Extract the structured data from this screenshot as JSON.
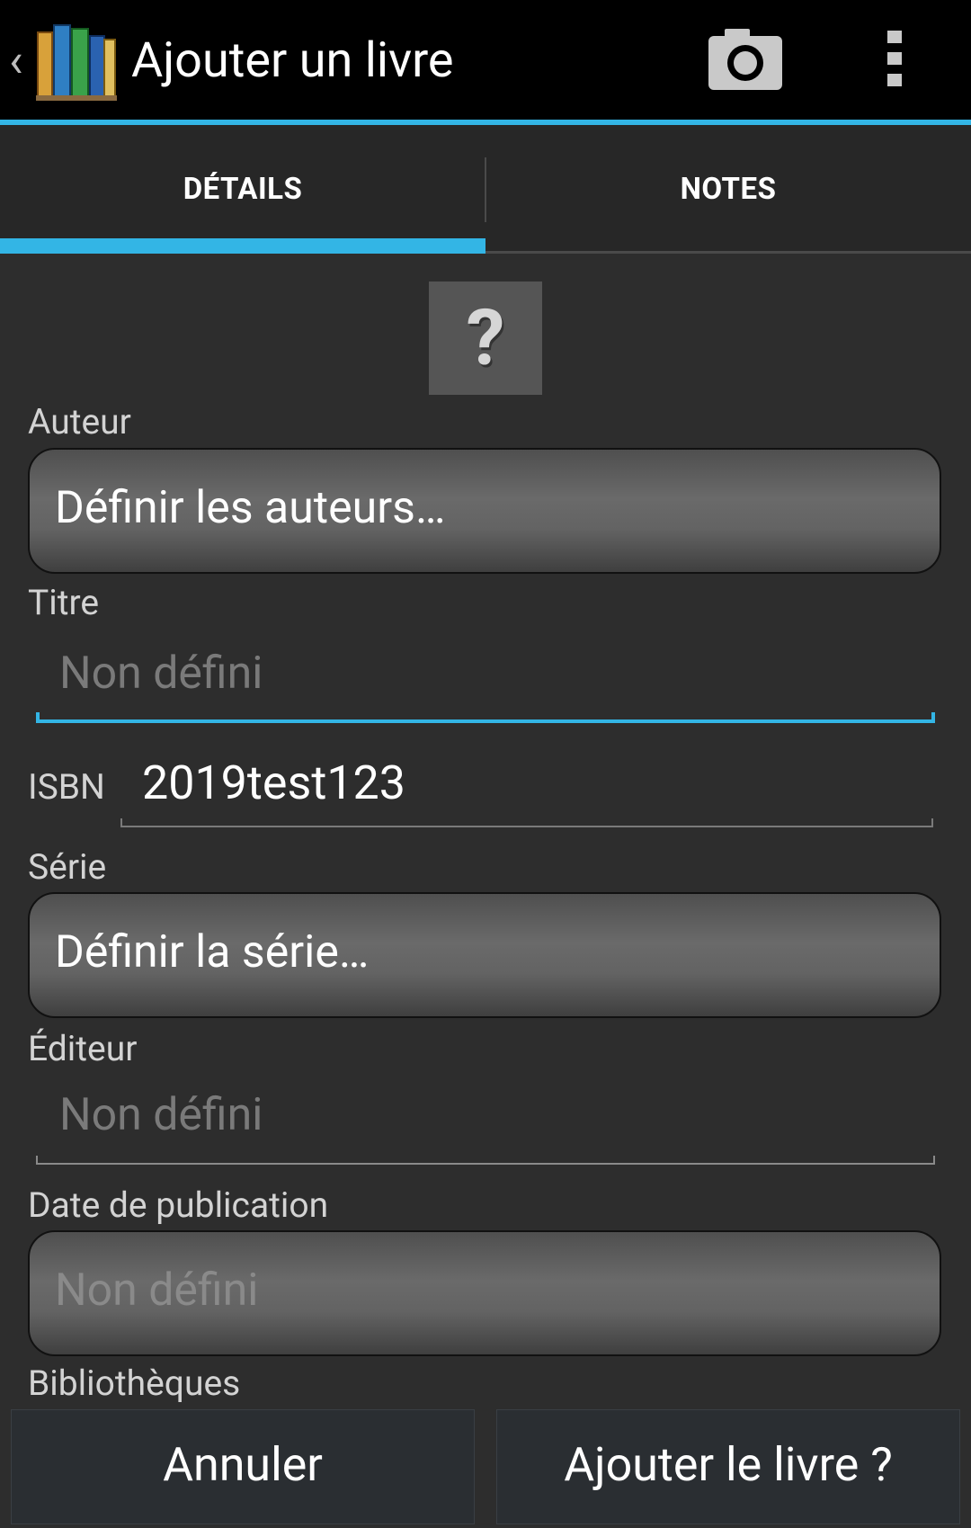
{
  "actionbar": {
    "title": "Ajouter un livre",
    "up_icon": "chevron-left-icon",
    "app_icon": "books-icon",
    "camera_icon": "camera-icon",
    "overflow_icon": "overflow-menu-icon",
    "accent_color": "#33b5e5"
  },
  "tabs": [
    {
      "label": "DÉTAILS",
      "selected": true
    },
    {
      "label": "NOTES",
      "selected": false
    }
  ],
  "cover": {
    "placeholder": "?"
  },
  "form": {
    "author_label": "Auteur",
    "author_button": "Définir les auteurs…",
    "title_label": "Titre",
    "title_placeholder": "Non défini",
    "isbn_label": "ISBN",
    "isbn_value": "2019test123",
    "series_label": "Série",
    "series_button": "Définir la série…",
    "publisher_label": "Éditeur",
    "publisher_placeholder": "Non défini",
    "pubdate_label": "Date de publication",
    "pubdate_placeholder": "Non défini",
    "libraries_label": "Bibliothèques"
  },
  "footer": {
    "cancel_label": "Annuler",
    "add_label": "Ajouter le livre ?"
  }
}
